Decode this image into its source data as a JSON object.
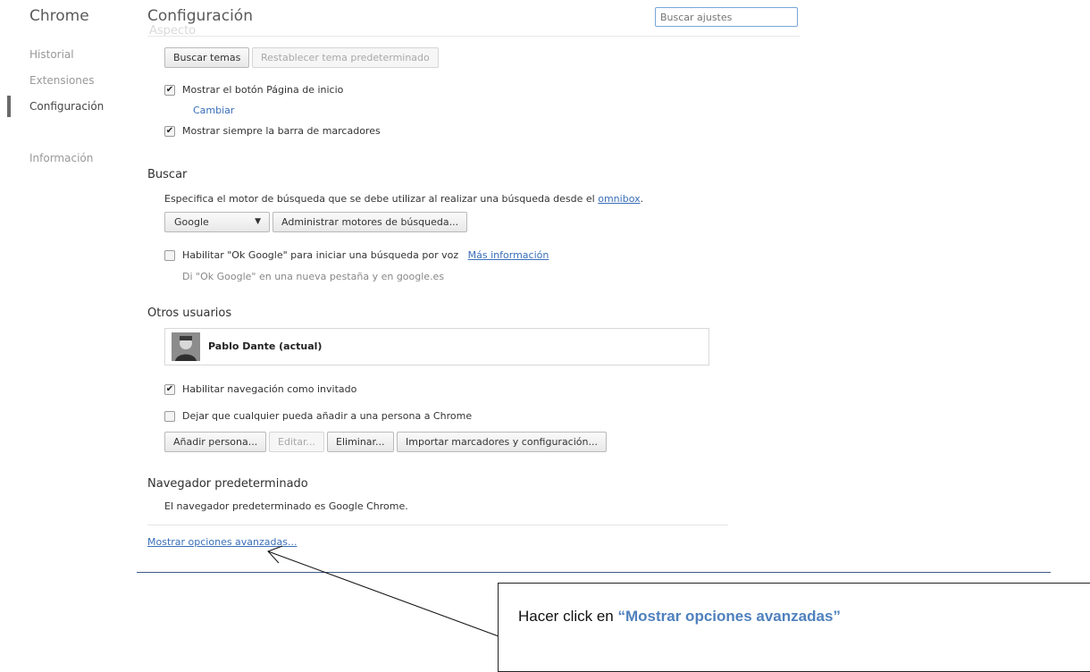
{
  "sidebar": {
    "brand": "Chrome",
    "items": [
      {
        "label": "Historial"
      },
      {
        "label": "Extensiones"
      },
      {
        "label": "Configuración"
      },
      {
        "label": "Información"
      }
    ]
  },
  "header": {
    "title": "Configuración",
    "search_placeholder": "Buscar ajustes",
    "faded_section": "Aspecto"
  },
  "appearance": {
    "find_themes": "Buscar temas",
    "reset_theme": "Restablecer tema predeterminado",
    "show_home": "Mostrar el botón Página de inicio",
    "change_link": "Cambiar",
    "show_bookmarks": "Mostrar siempre la barra de marcadores"
  },
  "search": {
    "heading": "Buscar",
    "desc_prefix": "Especifica el motor de búsqueda que se debe utilizar al realizar una búsqueda desde el",
    "desc_link": "omnibox",
    "desc_suffix": ".",
    "engine_selected": "Google",
    "manage_engines": "Administrar motores de búsqueda...",
    "ok_google": "Habilitar \"Ok Google\" para iniciar una búsqueda por voz",
    "more_info": "Más información",
    "ok_google_hint": "Di \"Ok Google\" en una nueva pestaña y en google.es"
  },
  "users": {
    "heading": "Otros usuarios",
    "current_user": "Pablo Dante (actual)",
    "guest_browsing": "Habilitar navegación como invitado",
    "let_anyone_add": "Dejar que cualquier pueda añadir a una persona a Chrome",
    "buttons": {
      "add": "Añadir persona...",
      "edit": "Editar...",
      "remove": "Eliminar...",
      "import": "Importar marcadores y configuración..."
    }
  },
  "default_browser": {
    "heading": "Navegador predeterminado",
    "status": "El navegador predeterminado es Google Chrome."
  },
  "advanced_link": "Mostrar opciones avanzadas...",
  "callout": {
    "prefix": "Hacer click en ",
    "highlight": "“Mostrar opciones avanzadas”"
  },
  "colors": {
    "link": "#3a6fb8",
    "callout_highlight": "#4f81bd",
    "divider": "#3c5a86"
  }
}
